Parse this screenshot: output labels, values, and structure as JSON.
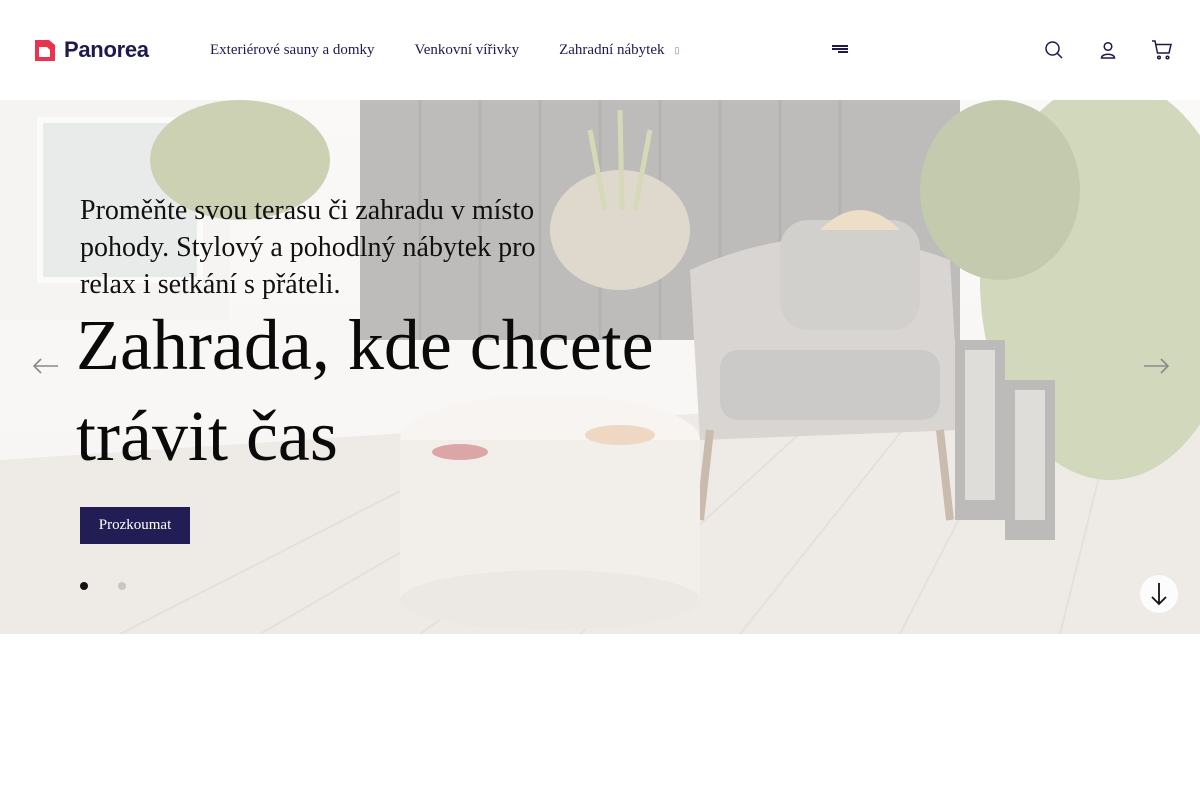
{
  "brand": {
    "name": "Panorea",
    "accent": "#e8344e",
    "navy": "#1f1a4e"
  },
  "nav": {
    "items": [
      {
        "label": "Exteriérové sauny a domky"
      },
      {
        "label": "Venkovní vířivky"
      },
      {
        "label": "Zahradní nábytek",
        "icon": "dropdown-icon"
      }
    ],
    "menu_icon": "hamburger-icon"
  },
  "header_icons": [
    "search-icon",
    "user-icon",
    "cart-icon"
  ],
  "hero": {
    "subtitle": "Proměňte svou terasu či zahradu v místo pohody. Stylový a pohodlný nábytek pro relax i setkání s přáteli.",
    "title": "Zahrada, kde chcete trávit čas",
    "cta_label": "Prozkoumat",
    "cta_color": "#221d55",
    "slides_total": 2,
    "active_slide": 1,
    "prev_icon": "arrow-left-icon",
    "next_icon": "arrow-right-icon",
    "scroll_icon": "arrow-down-icon"
  }
}
